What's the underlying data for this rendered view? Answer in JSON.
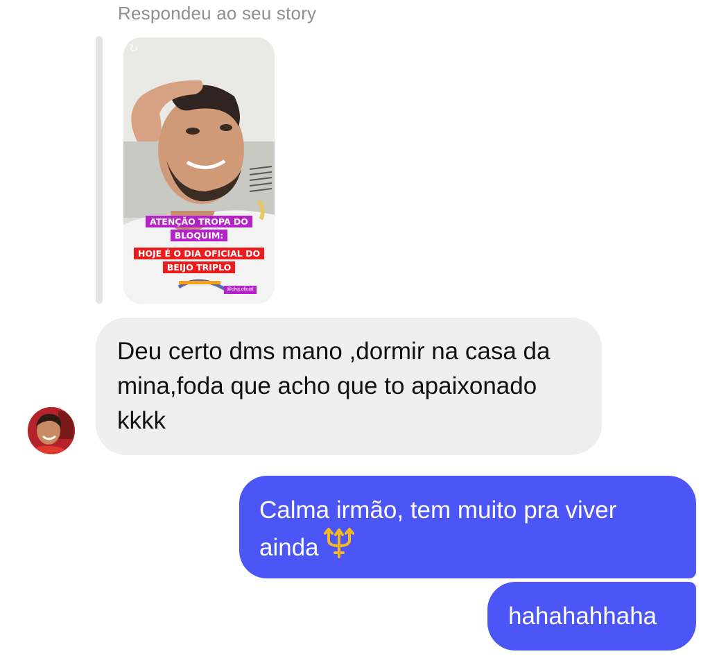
{
  "reply_context": {
    "caption": "Respondeu ao seu story"
  },
  "story": {
    "tag_line1": "ATENÇÃO TROPA DO BLOQUIM:",
    "tag_line2": "HOJE É O DIA OFICIAL DO BEIJO TRIPLO",
    "handle": "@clwj.oficial",
    "corner_icon": "refresh-icon"
  },
  "messages": [
    {
      "direction": "incoming",
      "text": "Deu certo dms mano ,dormir na casa da mina,foda que acho que to apaixonado kkkk"
    },
    {
      "direction": "outgoing",
      "text": "Calma irmão, tem muito pra viver ainda",
      "emoji": "trident-emoji"
    },
    {
      "direction": "outgoing",
      "text": "hahahahhaha"
    }
  ],
  "colors": {
    "incoming_bubble": "#efefef",
    "outgoing_bubble": "#4c55f6",
    "caption_gray": "#8e8e93"
  }
}
